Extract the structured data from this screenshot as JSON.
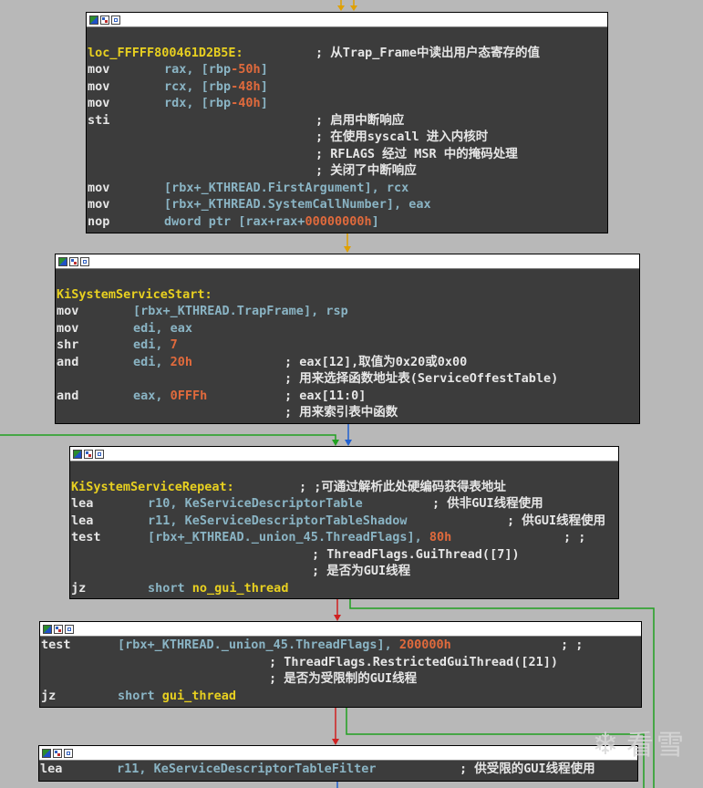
{
  "blocks": [
    {
      "name": "block-trap-frame",
      "lines": [
        {
          "type": "blank"
        },
        {
          "type": "label",
          "label": "loc_FFFFF800461D2B5E:",
          "comment": "; 从Trap_Frame中读出用户态寄存的值"
        },
        {
          "type": "ins",
          "mn": "mov",
          "ops": [
            {
              "t": "op",
              "v": "rax, ["
            },
            {
              "t": "op",
              "v": "rbp"
            },
            {
              "t": "num",
              "v": "-50h"
            },
            {
              "t": "op",
              "v": "]"
            }
          ]
        },
        {
          "type": "ins",
          "mn": "mov",
          "ops": [
            {
              "t": "op",
              "v": "rcx, ["
            },
            {
              "t": "op",
              "v": "rbp"
            },
            {
              "t": "num",
              "v": "-48h"
            },
            {
              "t": "op",
              "v": "]"
            }
          ]
        },
        {
          "type": "ins",
          "mn": "mov",
          "ops": [
            {
              "t": "op",
              "v": "rdx, ["
            },
            {
              "t": "op",
              "v": "rbp"
            },
            {
              "t": "num",
              "v": "-40h"
            },
            {
              "t": "op",
              "v": "]"
            }
          ]
        },
        {
          "type": "ins",
          "mn": "sti",
          "ops": [],
          "comment": "; 启用中断响应"
        },
        {
          "type": "cmt",
          "comment": "; 在使用syscall 进入内核时"
        },
        {
          "type": "cmt",
          "comment": "; RFLAGS 经过 MSR 中的掩码处理"
        },
        {
          "type": "cmt",
          "comment": "; 关闭了中断响应"
        },
        {
          "type": "ins",
          "mn": "mov",
          "ops": [
            {
              "t": "op",
              "v": "[rbx+"
            },
            {
              "t": "cmt",
              "v": "_KTHREAD.FirstArgument"
            },
            {
              "t": "op",
              "v": "], rcx"
            }
          ]
        },
        {
          "type": "ins",
          "mn": "mov",
          "ops": [
            {
              "t": "op",
              "v": "[rbx+"
            },
            {
              "t": "cmt",
              "v": "_KTHREAD.SystemCallNumber"
            },
            {
              "t": "op",
              "v": "], eax"
            }
          ]
        },
        {
          "type": "ins",
          "mn": "nop",
          "ops": [
            {
              "t": "op",
              "v": "dword ptr [rax+rax+"
            },
            {
              "t": "num",
              "v": "00000000h"
            },
            {
              "t": "op",
              "v": "]"
            }
          ]
        }
      ]
    },
    {
      "name": "block-kisystemservicestart",
      "lines": [
        {
          "type": "blank"
        },
        {
          "type": "label",
          "label": "KiSystemServiceStart:",
          "comment": ""
        },
        {
          "type": "ins",
          "mn": "mov",
          "ops": [
            {
              "t": "op",
              "v": "[rbx+"
            },
            {
              "t": "cmt",
              "v": "_KTHREAD.TrapFrame"
            },
            {
              "t": "op",
              "v": "], rsp"
            }
          ]
        },
        {
          "type": "ins",
          "mn": "mov",
          "ops": [
            {
              "t": "op",
              "v": "edi, eax"
            }
          ]
        },
        {
          "type": "ins",
          "mn": "shr",
          "ops": [
            {
              "t": "op",
              "v": "edi, "
            },
            {
              "t": "num",
              "v": "7"
            }
          ]
        },
        {
          "type": "ins",
          "mn": "and",
          "ops": [
            {
              "t": "op",
              "v": "edi, "
            },
            {
              "t": "num",
              "v": "20h"
            }
          ],
          "comment": "; eax[12],取值为0x20或0x00"
        },
        {
          "type": "cmt",
          "comment": "; 用来选择函数地址表(ServiceOffestTable)"
        },
        {
          "type": "ins",
          "mn": "and",
          "ops": [
            {
              "t": "op",
              "v": "eax, "
            },
            {
              "t": "num",
              "v": "0FFFh"
            }
          ],
          "comment": "; eax[11:0]"
        },
        {
          "type": "cmt",
          "comment": "; 用来索引表中函数"
        }
      ]
    },
    {
      "name": "block-kisystemservicerepeat",
      "lines": [
        {
          "type": "blank"
        },
        {
          "type": "label",
          "label": "KiSystemServiceRepeat:",
          "comment": "; ;可通过解析此处硬编码获得表地址"
        },
        {
          "type": "ins",
          "mn": "lea",
          "ops": [
            {
              "t": "op",
              "v": "r10, "
            },
            {
              "t": "cmt",
              "v": "KeServiceDescriptorTable"
            }
          ],
          "comment": "; 供非GUI线程使用"
        },
        {
          "type": "ins",
          "mn": "lea",
          "ops": [
            {
              "t": "op",
              "v": "r11, "
            },
            {
              "t": "cmt",
              "v": "KeServiceDescriptorTableShadow"
            }
          ],
          "comment": "; 供GUI线程使用"
        },
        {
          "type": "ins",
          "mn": "test",
          "ops": [
            {
              "t": "op",
              "v": "[rbx+"
            },
            {
              "t": "cmt",
              "v": "_KTHREAD._union_45.ThreadFlags"
            },
            {
              "t": "op",
              "v": "], "
            },
            {
              "t": "num",
              "v": "80h"
            }
          ],
          "comment": "; ;"
        },
        {
          "type": "cmt",
          "comment": "; ThreadFlags.GuiThread([7])"
        },
        {
          "type": "cmt",
          "comment": "; 是否为GUI线程"
        },
        {
          "type": "ins",
          "mn": "jz",
          "ops": [
            {
              "t": "op",
              "v": "short "
            },
            {
              "t": "ref",
              "v": "no_gui_thread"
            }
          ]
        }
      ]
    },
    {
      "name": "block-restricted-gui-test",
      "lines": [
        {
          "type": "ins",
          "mn": "test",
          "ops": [
            {
              "t": "op",
              "v": "[rbx+"
            },
            {
              "t": "cmt",
              "v": "_KTHREAD._union_45.ThreadFlags"
            },
            {
              "t": "op",
              "v": "], "
            },
            {
              "t": "num",
              "v": "200000h"
            }
          ],
          "comment": "; ;"
        },
        {
          "type": "cmt",
          "comment": "; ThreadFlags.RestrictedGuiThread([21])"
        },
        {
          "type": "cmt",
          "comment": "; 是否为受限制的GUI线程"
        },
        {
          "type": "ins",
          "mn": "jz",
          "ops": [
            {
              "t": "op",
              "v": "short "
            },
            {
              "t": "ref",
              "v": "gui_thread"
            }
          ]
        }
      ]
    },
    {
      "name": "block-filter-table",
      "lines": [
        {
          "type": "ins",
          "mn": "lea",
          "ops": [
            {
              "t": "op",
              "v": "r11, "
            },
            {
              "t": "cmt",
              "v": "KeServiceDescriptorTableFilter"
            }
          ],
          "comment": "; 供受限的GUI线程使用"
        }
      ]
    }
  ],
  "watermark": "看雪",
  "colors": {
    "background": "#b8b8b8",
    "block_bg": "#3c3c3c",
    "label": "#e8d020",
    "number": "#e06a3c",
    "operand": "#8ab4c4",
    "edge_normal": "#e0a000",
    "edge_true": "#20a020",
    "edge_false": "#d02020",
    "edge_back": "#2060d0"
  }
}
